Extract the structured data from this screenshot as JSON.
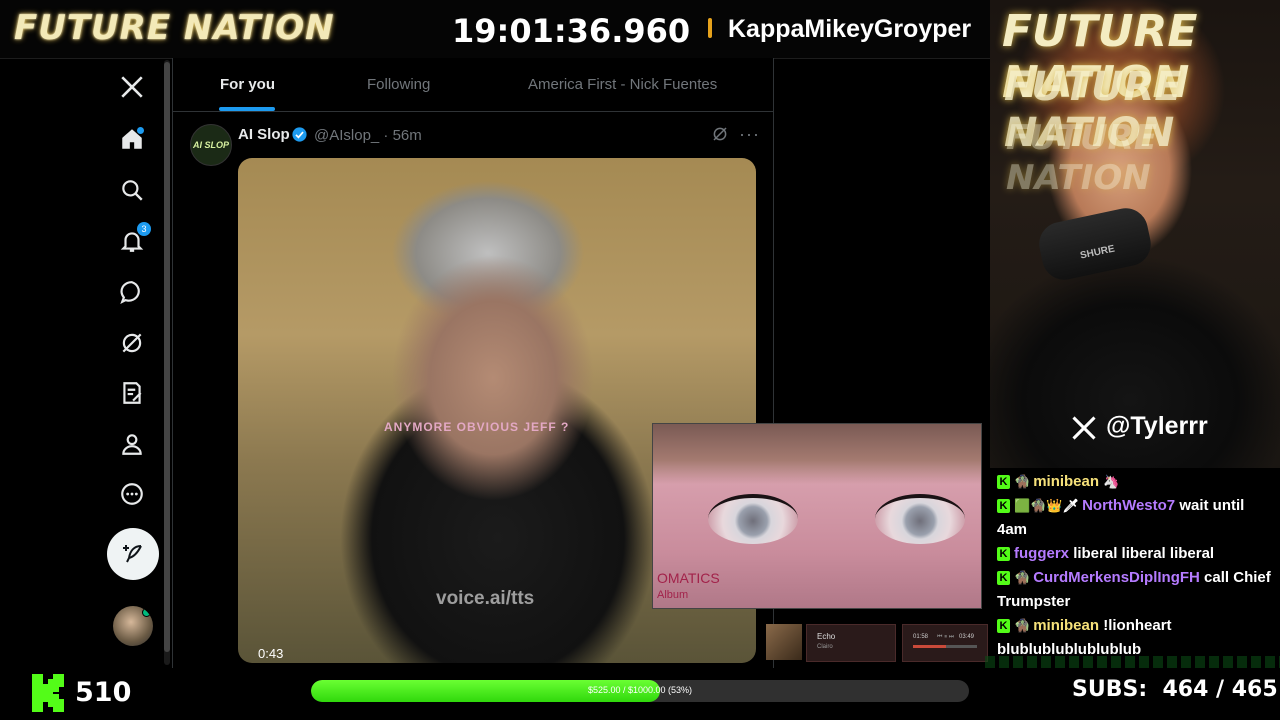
{
  "overlay": {
    "brand": "FUTURE NATION",
    "clock": "19:01:36.960",
    "ticker_name": "KappaMikeyGroyper"
  },
  "nav": {
    "notification_count": "3",
    "icons": [
      "x-logo-icon",
      "home-icon",
      "search-icon",
      "bell-icon",
      "chat-icon",
      "grok-icon",
      "compose-list-icon",
      "profile-icon",
      "more-icon"
    ]
  },
  "feed": {
    "tabs": [
      {
        "label": "For you",
        "active": true
      },
      {
        "label": "Following",
        "active": false
      },
      {
        "label": "America First - Nick Fuentes",
        "active": false
      }
    ],
    "tweet": {
      "avatar_text": "AI SLOP",
      "name": "AI Slop",
      "handle_time": "@AIslop_ · 56m",
      "video_caption": "ANYMORE OBVIOUS JEFF ?",
      "video_watermark": "voice.ai/tts",
      "duration": "0:43"
    }
  },
  "album_overlay": {
    "title": "OMATICS",
    "subtitle": "Album"
  },
  "mini_player": {
    "song": "Echo",
    "artist": "Clairo",
    "elapsed": "01:58",
    "total": "03:49",
    "progress": 0.52
  },
  "webcam": {
    "handle": "@Tylerrr",
    "mic_label": "SHURE"
  },
  "chat": {
    "messages": [
      {
        "user": "minibean",
        "text": "",
        "color": "yellow",
        "line": "1"
      },
      {
        "user": "NorthWesto7",
        "text": "wait until 4am",
        "color": "purple",
        "line": "2"
      },
      {
        "user": "fuggerx",
        "text": "liberal liberal liberal",
        "color": "purple",
        "line": "1"
      },
      {
        "user": "CurdMerkensDiplIngFH",
        "text": "call Chief Trumpster",
        "color": "purple",
        "line": "2"
      },
      {
        "user": "minibean",
        "text": "!lionheart blublublublublublub",
        "color": "yellow",
        "line": "2"
      }
    ]
  },
  "bottom": {
    "kick_count": "510",
    "goal_text": "$525.00 / $1000.00 (53%)",
    "goal_fraction": 0.53,
    "subs_label": "SUBS:",
    "subs_value": "464 / 465"
  },
  "colors": {
    "accent_blue": "#1d9bf0",
    "kick_green": "#53fc18",
    "brand_gold": "#f3e9b8"
  }
}
